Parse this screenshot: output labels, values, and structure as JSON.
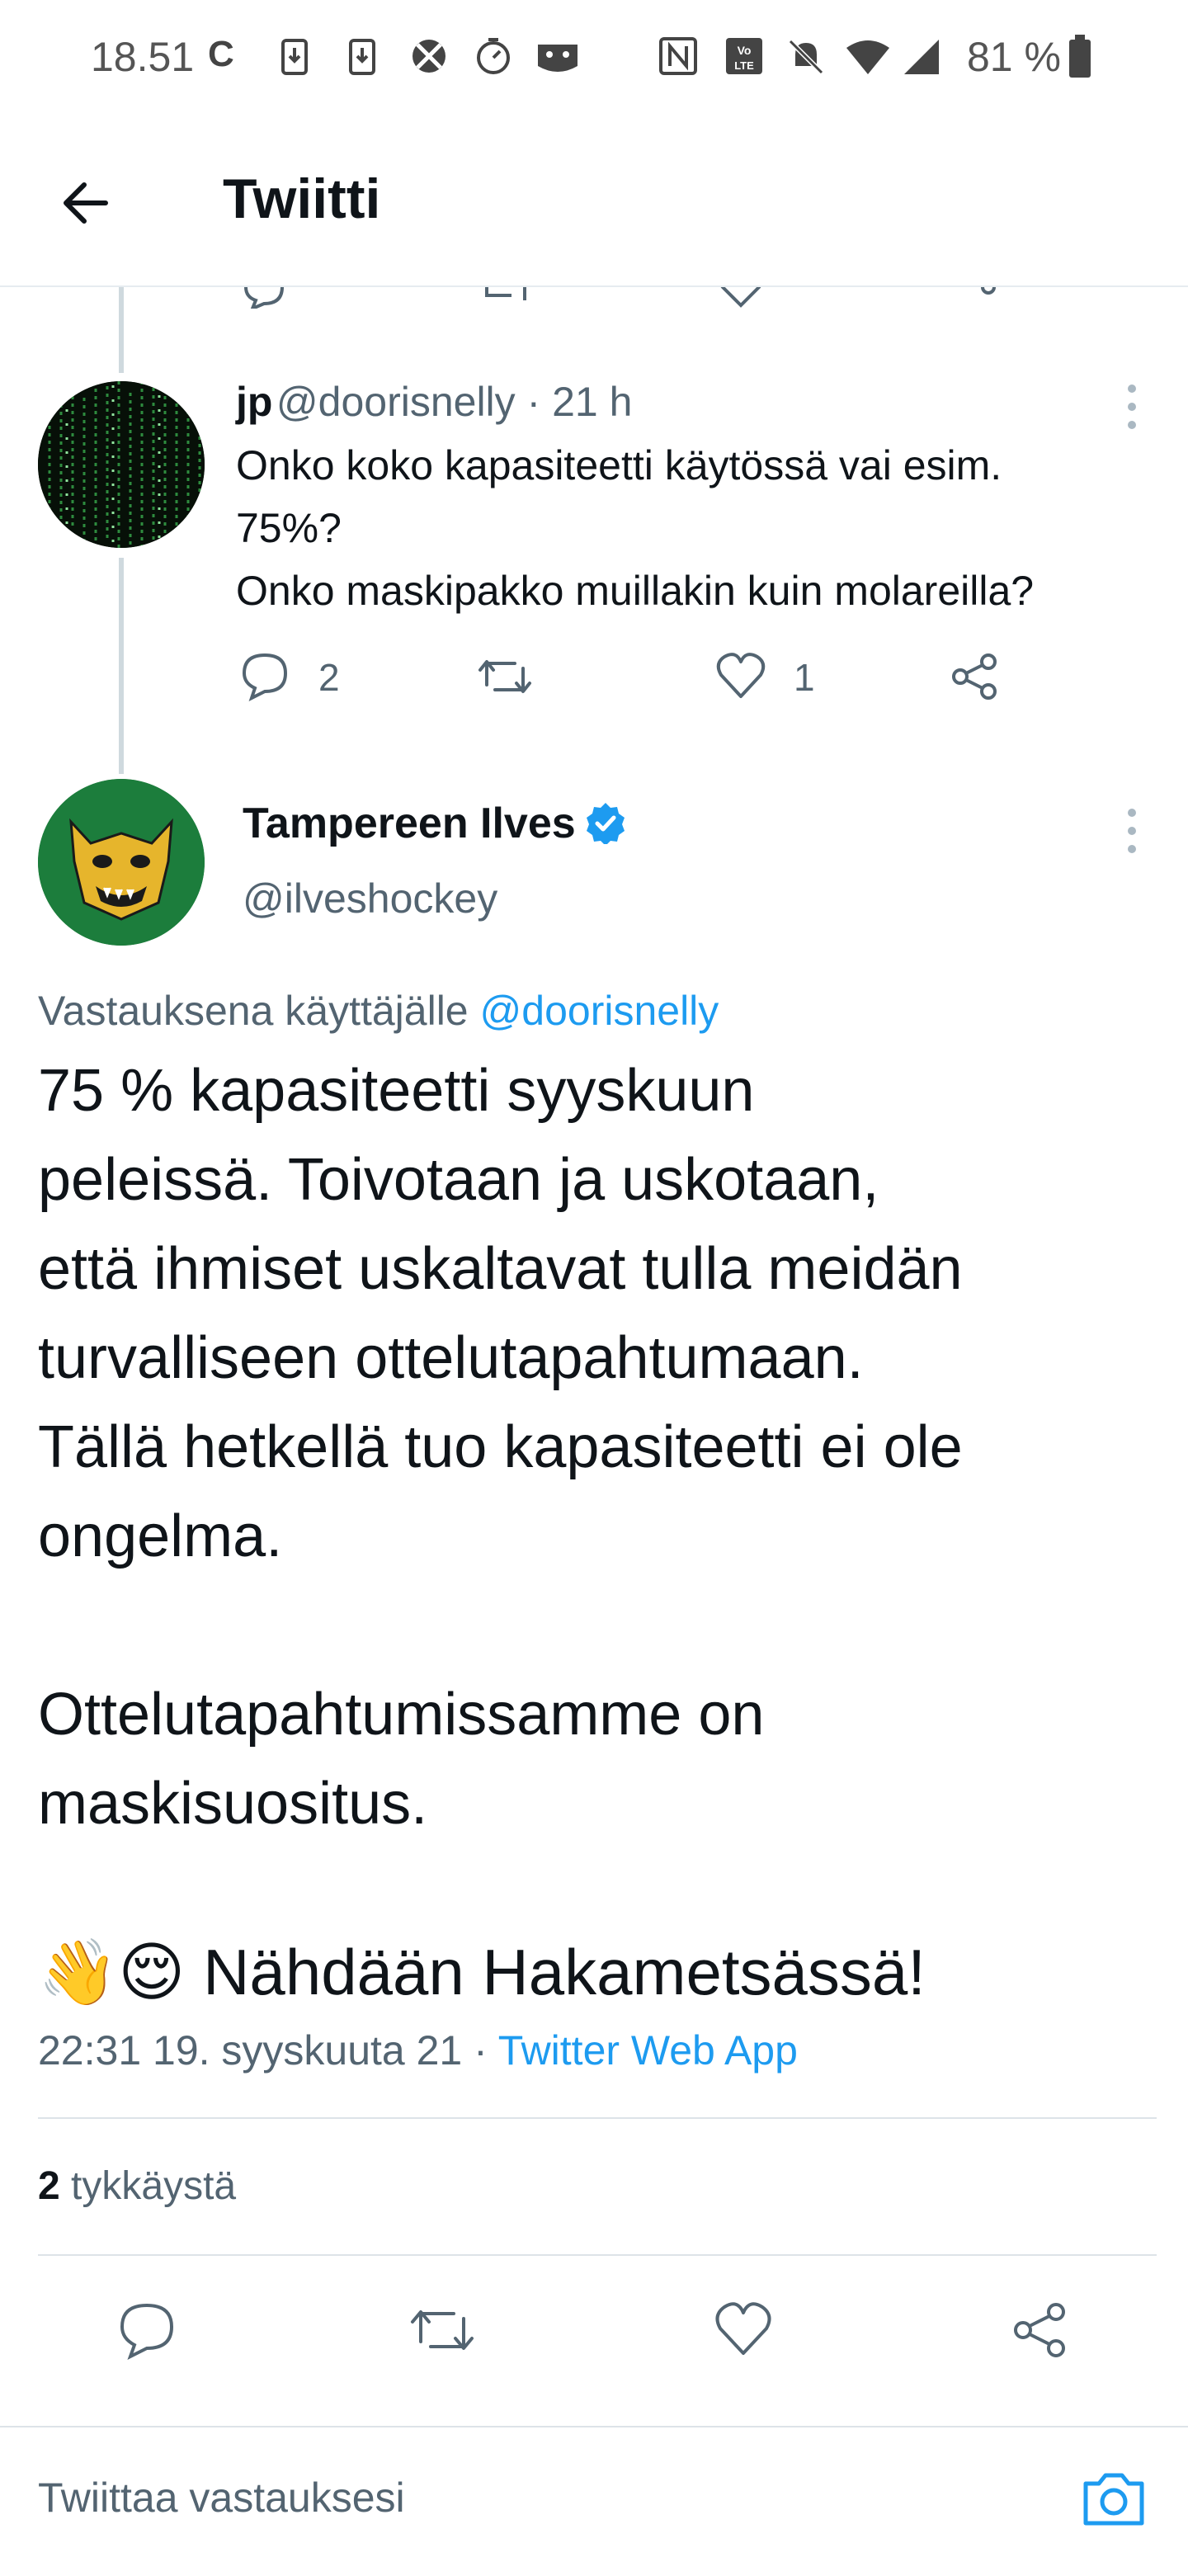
{
  "status_bar": {
    "time": "18.51",
    "battery": "81 %"
  },
  "header": {
    "title": "Twiitti"
  },
  "reply": {
    "name": "jp",
    "handle": "@doorisnelly · 21 h",
    "text_line1": "Onko koko kapasiteetti käytössä vai esim.",
    "text_line2": "75%?",
    "text_line3": "Onko maskipakko muillakin kuin molareilla?",
    "reply_count": "2",
    "like_count": "1"
  },
  "tweet": {
    "name": "Tampereen Ilves",
    "handle": "@ilveshockey",
    "reply_prefix": "Vastauksena käyttäjälle",
    "reply_to": "@doorisnelly",
    "body": "75 % kapasiteetti syyskuun\npeleissä. Toivotaan ja uskotaan,\nettä ihmiset uskaltavat tulla meidän\nturvalliseen ottelutapahtumaan.\nTällä hetkellä tuo kapasiteetti ei ole\nongelma.\n\nOttelutapahtumissamme on\nmaskisuositus.",
    "emoji_line": "👋😌 Nähdään Hakametsässä!",
    "timestamp": "22:31 19. syyskuuta 21 ·",
    "source": "Twitter Web App",
    "likes_count": "2",
    "likes_label": "tykkäystä"
  },
  "compose": {
    "placeholder": "Twiittaa vastauksesi"
  },
  "colors": {
    "accent": "#1d9bf0",
    "text": "#0f1419",
    "muted": "#536471"
  }
}
